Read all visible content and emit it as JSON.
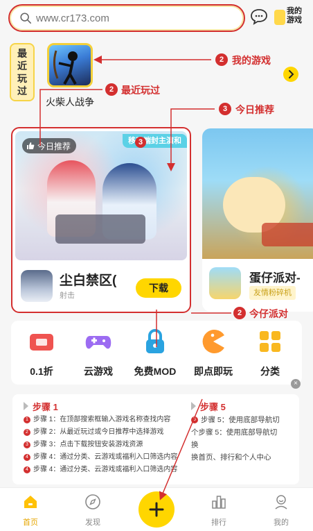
{
  "search": {
    "placeholder": "www.cr173.com"
  },
  "header": {
    "my_games_label": "我的游戏"
  },
  "recent": {
    "tab_chars": [
      "最",
      "近",
      "玩",
      "过"
    ],
    "game_name": "火柴人战争"
  },
  "annotations": {
    "my_games": {
      "num": "2",
      "text": "我的游戏"
    },
    "recent_played": {
      "num": "2",
      "text": "最近玩过"
    },
    "today_rec": {
      "num": "3",
      "text": "今日推荐"
    },
    "card_badge": {
      "num": "3"
    },
    "pet_party": {
      "num": "2",
      "text": "今仔派对"
    }
  },
  "cards": {
    "main": {
      "tag": "今日推荐",
      "promo": "移动端封主演和",
      "name": "尘白禁区(",
      "genre": "射击",
      "button": "下载"
    },
    "side": {
      "name": "蛋仔派对-",
      "tag": "友情粉碎机"
    }
  },
  "categories": [
    {
      "label": "0.1折",
      "icon": "ticket-icon"
    },
    {
      "label": "云游戏",
      "icon": "gamepad-icon"
    },
    {
      "label": "免费MOD",
      "icon": "lock-icon"
    },
    {
      "label": "即点即玩",
      "icon": "pacman-icon"
    },
    {
      "label": "分类",
      "icon": "grid-icon"
    }
  ],
  "steps": {
    "left": {
      "title": "步骤 1",
      "lines": [
        {
          "num": "1",
          "text": "步骤 1：在顶部搜索框输入游戏名称查找内容"
        },
        {
          "num": "2",
          "text": "步骤 2：从最近玩过或今日推荐中选择游戏"
        },
        {
          "num": "3",
          "text": "步骤 3：点击下载按钮安装游戏资源"
        },
        {
          "num": "4",
          "text": "步骤 4：通过分类、云游戏或福利入口筛选内容"
        },
        {
          "num": "4",
          "text": "步骤 4：通过分类、云游戏或福利入口筛选内容"
        }
      ]
    },
    "right": {
      "title": "步骤 5",
      "dot_num": "5",
      "body": "步骤 5：使用底部导航切换首页、排行和个人中心",
      "line1": "步骤 5：使用底部导航切",
      "line2": "个步骤 5：使用底部导航切换",
      "line3": "换首页、排行和个人中心"
    }
  },
  "nav": [
    {
      "label": "首页",
      "icon": "home-icon",
      "active": true
    },
    {
      "label": "发现",
      "icon": "compass-icon",
      "active": false
    },
    {
      "label": "排行",
      "icon": "ranking-icon",
      "active": false
    },
    {
      "label": "我的",
      "icon": "profile-icon",
      "active": false
    }
  ],
  "colors": {
    "accent": "#ffd600",
    "annotation": "#d32f2f",
    "active_nav": "#e6a600"
  }
}
